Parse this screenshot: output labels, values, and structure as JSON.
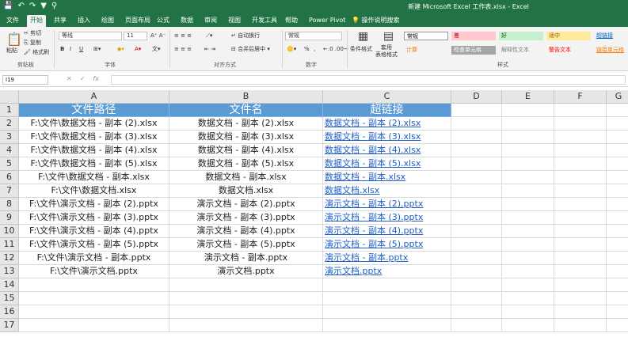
{
  "window": {
    "title": "新建 Microsoft Excel 工作表.xlsx - Excel",
    "qat": [
      "💾",
      "↶",
      "↷",
      "▼",
      "⚲"
    ]
  },
  "tabs": [
    "文件",
    "开始",
    "共享",
    "插入",
    "绘图",
    "页面布局",
    "公式",
    "数据",
    "审阅",
    "视图",
    "开发工具",
    "帮助",
    "Power Pivot",
    "操作说明搜索"
  ],
  "ribbon": {
    "clipboard": {
      "paste": "粘贴",
      "cut": "剪切",
      "copy": "复制",
      "format_painter": "格式刷",
      "label": "剪贴板"
    },
    "font": {
      "name": "等线",
      "size": "11",
      "label": "字体",
      "bold": "B",
      "italic": "I",
      "underline": "U"
    },
    "alignment": {
      "wrap": "自动换行",
      "merge": "合并后居中",
      "label": "对齐方式"
    },
    "number": {
      "format": "常规",
      "label": "数字",
      "percent": "%",
      "comma": ","
    },
    "styles": {
      "conditional": "条件格式",
      "table": "套用\n表格格式",
      "label": "样式",
      "cells": [
        {
          "text": "常规",
          "bg": "#ffffff",
          "fg": "#000000",
          "border": "#9a9a9a"
        },
        {
          "text": "差",
          "bg": "#ffc7ce",
          "fg": "#9c0006"
        },
        {
          "text": "好",
          "bg": "#c6efce",
          "fg": "#006100"
        },
        {
          "text": "适中",
          "bg": "#ffeb9c",
          "fg": "#9c5700"
        },
        {
          "text": "超链接",
          "bg": "#f3f3f3",
          "fg": "#0563c1"
        },
        {
          "text": "计算",
          "bg": "#f2f2f2",
          "fg": "#fa7d00"
        },
        {
          "text": "检查单元格",
          "bg": "#a5a5a5",
          "fg": "#ffffff"
        },
        {
          "text": "解释性文本",
          "bg": "#f3f3f3",
          "fg": "#7f7f7f"
        },
        {
          "text": "警告文本",
          "bg": "#f3f3f3",
          "fg": "#ff0000"
        },
        {
          "text": "链接单元格",
          "bg": "#f3f3f3",
          "fg": "#fa7d00"
        }
      ]
    }
  },
  "formula_bar": {
    "name_box": "I19",
    "fx": "fx"
  },
  "columns": [
    "A",
    "B",
    "C",
    "D",
    "E",
    "F",
    "G"
  ],
  "rows": [
    "1",
    "2",
    "3",
    "4",
    "5",
    "6",
    "7",
    "8",
    "9",
    "10",
    "11",
    "12",
    "13",
    "14",
    "15",
    "16",
    "17"
  ],
  "sheet": {
    "header": [
      "文件路径",
      "文件名",
      "超链接"
    ],
    "data": [
      [
        "F:\\文件\\数据文档 - 副本 (2).xlsx",
        "数据文档 - 副本 (2).xlsx",
        "数据文档 - 副本 (2).xlsx"
      ],
      [
        "F:\\文件\\数据文档 - 副本 (3).xlsx",
        "数据文档 - 副本 (3).xlsx",
        "数据文档 - 副本 (3).xlsx"
      ],
      [
        "F:\\文件\\数据文档 - 副本 (4).xlsx",
        "数据文档 - 副本 (4).xlsx",
        "数据文档 - 副本 (4).xlsx"
      ],
      [
        "F:\\文件\\数据文档 - 副本 (5).xlsx",
        "数据文档 - 副本 (5).xlsx",
        "数据文档 - 副本 (5).xlsx"
      ],
      [
        "F:\\文件\\数据文档 - 副本.xlsx",
        "数据文档 - 副本.xlsx",
        "数据文档 - 副本.xlsx"
      ],
      [
        "F:\\文件\\数据文档.xlsx",
        "数据文档.xlsx",
        "数据文档.xlsx"
      ],
      [
        "F:\\文件\\演示文档 - 副本 (2).pptx",
        "演示文档 - 副本 (2).pptx",
        "演示文档 - 副本 (2).pptx"
      ],
      [
        "F:\\文件\\演示文档 - 副本 (3).pptx",
        "演示文档 - 副本 (3).pptx",
        "演示文档 - 副本 (3).pptx"
      ],
      [
        "F:\\文件\\演示文档 - 副本 (4).pptx",
        "演示文档 - 副本 (4).pptx",
        "演示文档 - 副本 (4).pptx"
      ],
      [
        "F:\\文件\\演示文档 - 副本 (5).pptx",
        "演示文档 - 副本 (5).pptx",
        "演示文档 - 副本 (5).pptx"
      ],
      [
        "F:\\文件\\演示文档 - 副本.pptx",
        "演示文档 - 副本.pptx",
        "演示文档 - 副本.pptx"
      ],
      [
        "F:\\文件\\演示文档.pptx",
        "演示文档.pptx",
        "演示文档.pptx"
      ]
    ]
  },
  "colors": {
    "accent": "#217346",
    "header_fill": "#5b9bd5",
    "link": "#1f5ec8"
  }
}
